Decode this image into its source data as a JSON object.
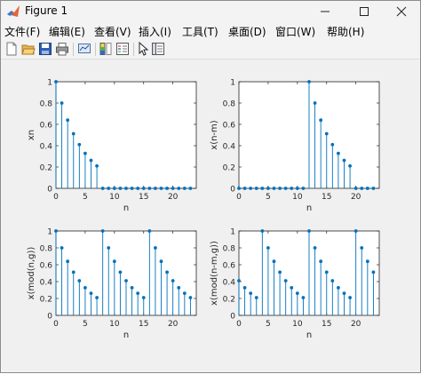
{
  "window": {
    "title": "Figure 1"
  },
  "menu": [
    "文件(F)",
    "编辑(E)",
    "查看(V)",
    "插入(I)",
    "工具(T)",
    "桌面(D)",
    "窗口(W)",
    "帮助(H)"
  ],
  "toolbar_icons": [
    "new-figure-icon",
    "open-file-icon",
    "save-icon",
    "print-icon",
    "link-plot-icon",
    "insert-colorbar-icon",
    "insert-legend-icon",
    "edit-plot-arrow-icon",
    "property-inspector-icon"
  ],
  "colors": {
    "stem": "#0072bd",
    "axes": "#262626",
    "plot_bg": "#ffffff",
    "figure_bg": "#f0f0f0"
  },
  "chart_data": [
    {
      "type": "stem",
      "title": "",
      "xlabel": "n",
      "ylabel": "xn",
      "xlim": [
        0,
        24
      ],
      "ylim": [
        0,
        1
      ],
      "xticks": [
        "0",
        "5",
        "10",
        "15",
        "20"
      ],
      "yticks": [
        "0",
        "0.2",
        "0.4",
        "0.6",
        "0.8",
        "1"
      ],
      "x": [
        0,
        1,
        2,
        3,
        4,
        5,
        6,
        7,
        8,
        9,
        10,
        11,
        12,
        13,
        14,
        15,
        16,
        17,
        18,
        19,
        20,
        21,
        22,
        23
      ],
      "y": [
        1,
        0.8,
        0.64,
        0.512,
        0.41,
        0.328,
        0.262,
        0.21,
        0,
        0,
        0,
        0,
        0,
        0,
        0,
        0,
        0,
        0,
        0,
        0,
        0,
        0,
        0,
        0
      ]
    },
    {
      "type": "stem",
      "title": "",
      "xlabel": "n",
      "ylabel": "x(n-m)",
      "xlim": [
        0,
        24
      ],
      "ylim": [
        0,
        1
      ],
      "xticks": [
        "0",
        "5",
        "10",
        "15",
        "20"
      ],
      "yticks": [
        "0",
        "0.2",
        "0.4",
        "0.6",
        "0.8",
        "1"
      ],
      "x": [
        0,
        1,
        2,
        3,
        4,
        5,
        6,
        7,
        8,
        9,
        10,
        11,
        12,
        13,
        14,
        15,
        16,
        17,
        18,
        19,
        20,
        21,
        22,
        23
      ],
      "y": [
        0,
        0,
        0,
        0,
        0,
        0,
        0,
        0,
        0,
        0,
        0,
        0,
        1,
        0.8,
        0.64,
        0.512,
        0.41,
        0.328,
        0.262,
        0.21,
        0,
        0,
        0,
        0
      ]
    },
    {
      "type": "stem",
      "title": "",
      "xlabel": "n",
      "ylabel": "x(mod(n,g))",
      "xlim": [
        0,
        24
      ],
      "ylim": [
        0,
        1
      ],
      "xticks": [
        "0",
        "5",
        "10",
        "15",
        "20"
      ],
      "yticks": [
        "0",
        "0.2",
        "0.4",
        "0.6",
        "0.8",
        "1"
      ],
      "x": [
        0,
        1,
        2,
        3,
        4,
        5,
        6,
        7,
        8,
        9,
        10,
        11,
        12,
        13,
        14,
        15,
        16,
        17,
        18,
        19,
        20,
        21,
        22,
        23
      ],
      "y": [
        1,
        0.8,
        0.64,
        0.512,
        0.41,
        0.328,
        0.262,
        0.21,
        1,
        0.8,
        0.64,
        0.512,
        0.41,
        0.328,
        0.262,
        0.21,
        1,
        0.8,
        0.64,
        0.512,
        0.41,
        0.328,
        0.262,
        0.21
      ]
    },
    {
      "type": "stem",
      "title": "",
      "xlabel": "n",
      "ylabel": "x(mod(n-m,g))",
      "xlim": [
        0,
        24
      ],
      "ylim": [
        0,
        1
      ],
      "xticks": [
        "0",
        "5",
        "10",
        "15",
        "20"
      ],
      "yticks": [
        "0",
        "0.2",
        "0.4",
        "0.6",
        "0.8",
        "1"
      ],
      "x": [
        0,
        1,
        2,
        3,
        4,
        5,
        6,
        7,
        8,
        9,
        10,
        11,
        12,
        13,
        14,
        15,
        16,
        17,
        18,
        19,
        20,
        21,
        22,
        23
      ],
      "y": [
        0.41,
        0.328,
        0.262,
        0.21,
        1,
        0.8,
        0.64,
        0.512,
        0.41,
        0.328,
        0.262,
        0.21,
        1,
        0.8,
        0.64,
        0.512,
        0.41,
        0.328,
        0.262,
        0.21,
        1,
        0.8,
        0.64,
        0.512
      ]
    }
  ]
}
